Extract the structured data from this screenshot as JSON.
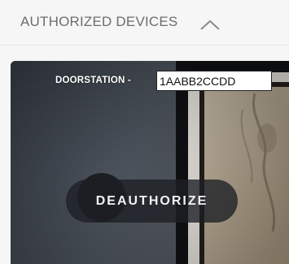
{
  "section": {
    "title": "AUTHORIZED DEVICES",
    "toggle_icon": "chevron-up-icon",
    "title_color": "#6d6d6d"
  },
  "device": {
    "label": "DOORSTATION - ",
    "id_value": "1AABB2CCDD",
    "action_label": "DEAUTHORIZE"
  },
  "colors": {
    "background": "#f6f6f6",
    "card_overlay": "#3e444d",
    "button_bg": "#1c1f24",
    "text_light": "#ffffff"
  }
}
